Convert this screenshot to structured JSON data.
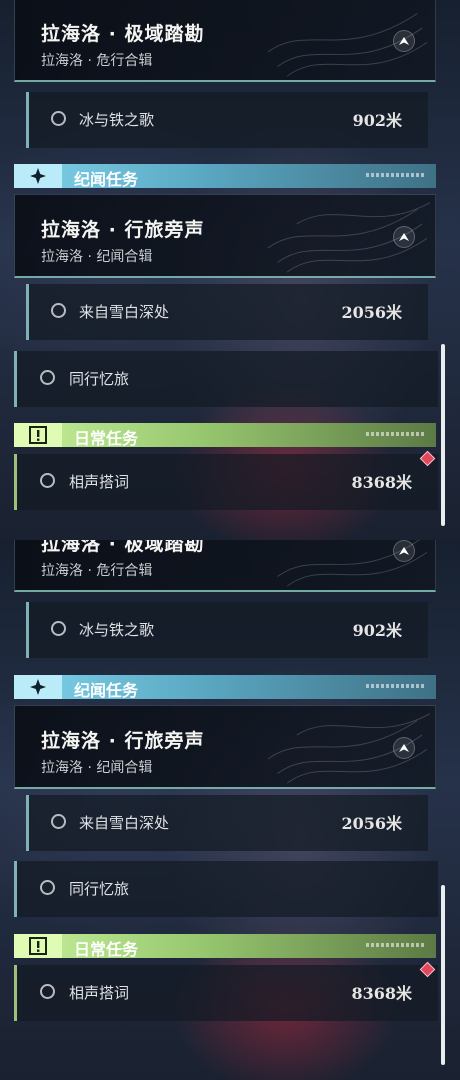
{
  "main_quest_card": {
    "title": "拉海洛 · 极域踏勘",
    "subtitle": "拉海洛 · 危行合辑",
    "objective": {
      "label": "冰与铁之歌",
      "distance": "902米"
    }
  },
  "side_section": {
    "header": "纪闻任务",
    "card_title": "拉海洛 · 行旅旁声",
    "card_subtitle": "拉海洛 · 纪闻合辑",
    "objective": {
      "label": "来自雪白深处",
      "distance": "2056米"
    },
    "extra_item": {
      "label": "同行忆旅"
    }
  },
  "daily_section": {
    "header": "日常任务",
    "item": {
      "label": "相声搭词",
      "distance": "8368米"
    }
  },
  "icons": {
    "side_header_icon": "sparkle-icon",
    "daily_header_icon": "exclamation-box-icon",
    "nav_icon": "navigate-arrow-icon",
    "tracked_marker": "red-diamond-marker-icon"
  },
  "colors": {
    "side_accent": "#7fd3ea",
    "daily_accent": "#c7f19a",
    "marker": "#e2475b"
  }
}
